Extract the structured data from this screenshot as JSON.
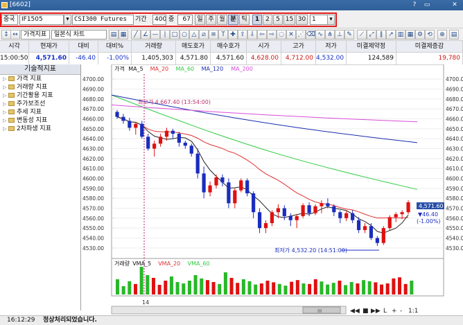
{
  "window": {
    "title": "[6602]",
    "help_glyph": "?",
    "minimize_glyph": "▭",
    "close_glyph": "✕"
  },
  "toolbar": {
    "market": "중국",
    "code": "IF1505",
    "name": "CSI300 Futures",
    "period_label": "기간",
    "period_value": "400",
    "count_label": "중",
    "count_value": "67",
    "timeframes": [
      "일",
      "주",
      "월",
      "분",
      "틱"
    ],
    "active_timeframe": "분",
    "intervals": [
      "1",
      "2",
      "5",
      "15",
      "30"
    ],
    "interval_value": "1"
  },
  "toolbar2": {
    "price_index_label": "가격지표",
    "chart_type": "일본식 차트"
  },
  "quote": {
    "headers": [
      "시각",
      "현재가",
      "대비",
      "대비%",
      "거래량",
      "매도호가",
      "매수호가",
      "시가",
      "고가",
      "저가",
      "미결제약정",
      "미결제증감"
    ],
    "values": [
      "15:00:50",
      "4,571.60",
      "-46.40",
      "-1.00%",
      "1,405,303",
      "4,571.80",
      "4,571.60",
      "4,628.00",
      "4,712.00",
      "4,532.00",
      "124,589",
      "19,780"
    ]
  },
  "left_panel": {
    "title": "기술적지표",
    "items": [
      "가격 지표",
      "거래량 지표",
      "기간활용 지표",
      "주가보조선",
      "추세 지표",
      "변동성 지표",
      "2차파생 지표"
    ]
  },
  "chart": {
    "price_legend": [
      "가격",
      "MA_5",
      "MA_20",
      "MA_60",
      "MA_120",
      "MA_200"
    ],
    "volume_legend": [
      "거래량",
      "VMA_5",
      "VMA_20",
      "VMA_60"
    ],
    "high_annotation": "최고가 4,667.40 (13:54:00)",
    "low_annotation": "최저가 4,532.20 (14:51:00)",
    "price_ticks": [
      "4700.00",
      "4690.00",
      "4680.00",
      "4670.00",
      "4660.00",
      "4650.00",
      "4640.00",
      "4630.00",
      "4620.00",
      "4610.00",
      "4600.00",
      "4590.00",
      "4580.00",
      "4570.00",
      "4560.00",
      "4550.00",
      "4540.00",
      "4530.00"
    ],
    "current_badge": "4,571.60",
    "change_badge": "▼46.40",
    "change_pct_badge": "(-1.00%)",
    "x_tick": "14",
    "scroll_center": "III",
    "nav_buttons": [
      "◀◀",
      "■",
      "▶▶",
      "L",
      "+",
      "-",
      "1:1"
    ]
  },
  "colors": {
    "up": "#e01010",
    "down": "#1a2dbf",
    "ma5": "#222222",
    "ma20": "#e03030",
    "ma60": "#2ecc40",
    "ma120": "#1a2db0",
    "ma200": "#d84dd8",
    "highlight": "#e41c1c"
  },
  "status": {
    "time": "16:12:29",
    "message": "정상처리되었습니다."
  },
  "chart_data": {
    "type": "candlestick",
    "y_range": [
      4525,
      4705
    ],
    "candles_ohlc": [
      [
        4667,
        4669,
        4660,
        4662
      ],
      [
        4662,
        4665,
        4655,
        4658
      ],
      [
        4658,
        4661,
        4648,
        4651
      ],
      [
        4651,
        4657,
        4644,
        4655
      ],
      [
        4655,
        4658,
        4640,
        4642
      ],
      [
        4642,
        4645,
        4628,
        4630
      ],
      [
        4630,
        4638,
        4622,
        4635
      ],
      [
        4635,
        4645,
        4632,
        4642
      ],
      [
        4642,
        4651,
        4638,
        4648
      ],
      [
        4648,
        4650,
        4640,
        4645
      ],
      [
        4645,
        4647,
        4632,
        4636
      ],
      [
        4636,
        4638,
        4630,
        4633
      ],
      [
        4633,
        4635,
        4622,
        4625
      ],
      [
        4625,
        4630,
        4600,
        4605
      ],
      [
        4605,
        4612,
        4580,
        4586
      ],
      [
        4586,
        4597,
        4582,
        4593
      ],
      [
        4593,
        4604,
        4590,
        4601
      ],
      [
        4601,
        4604,
        4592,
        4596
      ],
      [
        4596,
        4600,
        4570,
        4575
      ],
      [
        4575,
        4590,
        4570,
        4588
      ],
      [
        4588,
        4600,
        4586,
        4598
      ],
      [
        4598,
        4600,
        4582,
        4585
      ],
      [
        4585,
        4587,
        4560,
        4566
      ],
      [
        4566,
        4570,
        4545,
        4550
      ],
      [
        4550,
        4558,
        4545,
        4555
      ],
      [
        4555,
        4568,
        4552,
        4566
      ],
      [
        4566,
        4574,
        4560,
        4570
      ],
      [
        4570,
        4573,
        4558,
        4562
      ],
      [
        4562,
        4565,
        4552,
        4558
      ],
      [
        4558,
        4564,
        4550,
        4562
      ],
      [
        4562,
        4575,
        4560,
        4573
      ],
      [
        4573,
        4576,
        4562,
        4565
      ],
      [
        4565,
        4574,
        4563,
        4572
      ],
      [
        4572,
        4578,
        4565,
        4575
      ],
      [
        4575,
        4580,
        4570,
        4572
      ],
      [
        4572,
        4574,
        4562,
        4566
      ],
      [
        4566,
        4568,
        4555,
        4560
      ],
      [
        4560,
        4568,
        4557,
        4565
      ],
      [
        4565,
        4568,
        4555,
        4558
      ],
      [
        4558,
        4561,
        4545,
        4548
      ],
      [
        4548,
        4555,
        4545,
        4552
      ],
      [
        4552,
        4555,
        4538,
        4540
      ],
      [
        4540,
        4542,
        4532,
        4535
      ],
      [
        4535,
        4552,
        4533,
        4550
      ],
      [
        4550,
        4563,
        4548,
        4561
      ],
      [
        4561,
        4566,
        4556,
        4564
      ],
      [
        4564,
        4568,
        4559,
        4566
      ],
      [
        4566,
        4578,
        4564,
        4576
      ]
    ],
    "volumes": [
      55,
      30,
      48,
      38,
      100,
      70,
      60,
      35,
      50,
      65,
      45,
      40,
      50,
      70,
      58,
      52,
      45,
      38,
      80,
      60,
      42,
      55,
      48,
      36,
      40,
      50,
      44,
      38,
      32,
      46,
      52,
      40,
      38,
      55,
      47,
      36,
      42,
      50,
      34,
      45,
      40,
      52,
      48,
      44,
      36,
      40,
      58,
      62,
      38,
      50
    ]
  }
}
